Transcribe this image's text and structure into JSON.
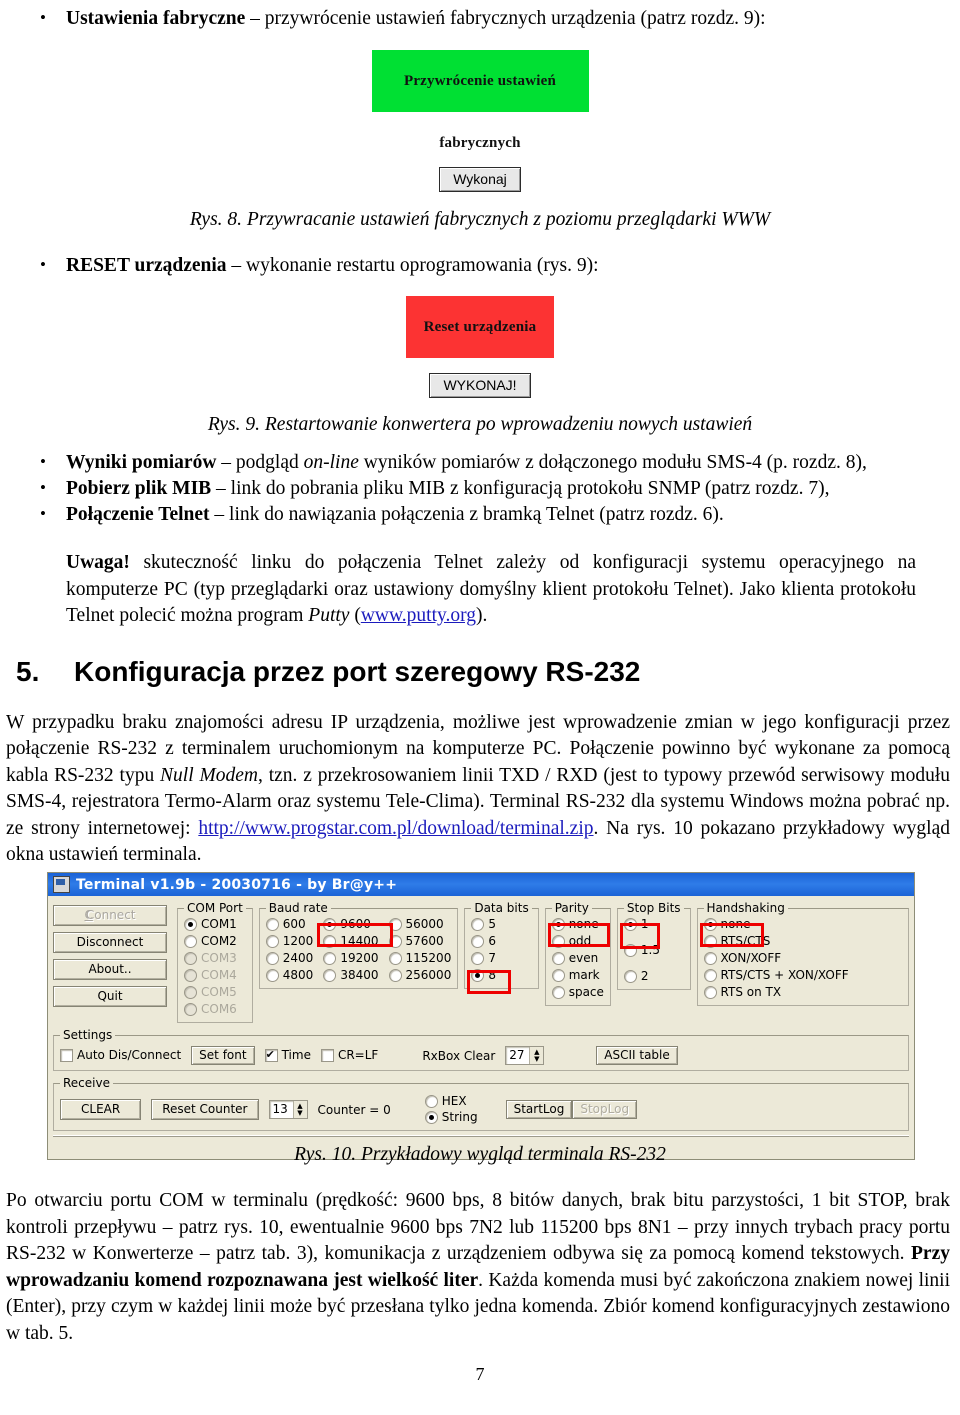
{
  "bullets_top": [
    {
      "label": "Ustawienia fabryczne",
      "rest": " – przywrócenie ustawień fabrycznych urządzenia (patrz rozdz. 9):"
    },
    {
      "label": "RESET urządzenia",
      "rest": " – wykonanie restartu oprogramowania (rys. 9):"
    }
  ],
  "figure8": {
    "banner_label": "Przywrócenie ustawień fabrycznych",
    "banner_color": "#00e033",
    "button_label": "Wykonaj",
    "caption": "Rys. 8. Przywracanie ustawień fabrycznych z poziomu przeglądarki WWW"
  },
  "figure9": {
    "banner_label": "Reset urządzenia",
    "banner_color": "#fc3333",
    "button_label": "WYKONAJ!",
    "caption": "Rys. 9. Restartowanie konwertera po wprowadzeniu nowych ustawień"
  },
  "bullets_links": [
    {
      "label": "Wyniki pomiarów",
      "pre": " – podgląd ",
      "em": "on-line",
      "post": " wyników pomiarów z dołączonego modułu SMS-4 (p. rozdz. 8),"
    },
    {
      "label": "Pobierz plik MIB",
      "pre": " – link do pobrania pliku MIB z konfiguracją protokołu SNMP (patrz rozdz. 7),",
      "em": "",
      "post": ""
    },
    {
      "label": "Połączenie Telnet",
      "pre": " – link do nawiązania połączenia z bramką Telnet (patrz rozdz. 6).",
      "em": "",
      "post": ""
    }
  ],
  "note": {
    "label": "Uwaga!",
    "text_1": " skuteczność linku do połączenia Telnet zależy od konfiguracji systemu operacyjnego na komputerze PC (typ przeglądarki oraz ustawiony domyślny klient protokołu Telnet). Jako klienta protokołu Telnet polecić można program ",
    "program": "Putty",
    "open_paren": " (",
    "link": "www.putty.org",
    "close_paren": ")."
  },
  "section5": {
    "number": "5.",
    "title": "Konfiguracja przez port szeregowy RS-232",
    "para_1": "W przypadku braku znajomości adresu IP urządzenia, możliwe jest wprowadzenie zmian w jego konfiguracji przez połączenie RS-232 z terminalem uruchomionym na komputerze PC. Połączenie powinno być wykonane za pomocą kabla RS-232 typu ",
    "em_1": "Null Modem",
    "para_2": ", tzn. z przekrosowaniem linii TXD / RXD (jest to typowy przewód serwisowy modułu SMS-4, rejestratora Termo-Alarm oraz systemu Tele-Clima). Terminal RS-232 dla systemu Windows można pobrać np. ze strony internetowej: ",
    "link": "http://www.progstar.com.pl/download/terminal.zip",
    "para_3": ". Na rys. 10 pokazano przykładowy wygląd okna ustawień terminala."
  },
  "terminal": {
    "title": "Terminal v1.9b - 20030716 - by Br@y++",
    "title_bar_color": "#1b63d6",
    "highlight_color": "#ee0000",
    "buttons": [
      {
        "label": "Connect",
        "disabled": true
      },
      {
        "label": "Disconnect",
        "disabled": false
      },
      {
        "label": "About..",
        "disabled": false
      },
      {
        "label": "Quit",
        "disabled": false
      }
    ],
    "com_port": {
      "legend": "COM Port",
      "options": [
        {
          "label": "COM1",
          "selected": true,
          "disabled": false
        },
        {
          "label": "COM2",
          "selected": false,
          "disabled": false
        },
        {
          "label": "COM3",
          "selected": false,
          "disabled": true
        },
        {
          "label": "COM4",
          "selected": false,
          "disabled": true
        },
        {
          "label": "COM5",
          "selected": false,
          "disabled": true
        },
        {
          "label": "COM6",
          "selected": false,
          "disabled": true
        }
      ]
    },
    "baud_rate": {
      "legend": "Baud rate",
      "columns": [
        [
          {
            "label": "600",
            "selected": false
          },
          {
            "label": "1200",
            "selected": false
          },
          {
            "label": "2400",
            "selected": false
          },
          {
            "label": "4800",
            "selected": false
          }
        ],
        [
          {
            "label": "9600",
            "selected": true
          },
          {
            "label": "14400",
            "selected": false
          },
          {
            "label": "19200",
            "selected": false
          },
          {
            "label": "38400",
            "selected": false
          }
        ],
        [
          {
            "label": "56000",
            "selected": false
          },
          {
            "label": "57600",
            "selected": false
          },
          {
            "label": "115200",
            "selected": false
          },
          {
            "label": "256000",
            "selected": false
          }
        ]
      ]
    },
    "data_bits": {
      "legend": "Data bits",
      "options": [
        {
          "label": "5",
          "selected": false
        },
        {
          "label": "6",
          "selected": false
        },
        {
          "label": "7",
          "selected": false
        },
        {
          "label": "8",
          "selected": true
        }
      ]
    },
    "parity": {
      "legend": "Parity",
      "options": [
        {
          "label": "none",
          "selected": true
        },
        {
          "label": "odd",
          "selected": false
        },
        {
          "label": "even",
          "selected": false
        },
        {
          "label": "mark",
          "selected": false
        },
        {
          "label": "space",
          "selected": false
        }
      ]
    },
    "stop_bits": {
      "legend": "Stop Bits",
      "options": [
        {
          "label": "1",
          "selected": true
        },
        {
          "label": "1.5",
          "selected": false
        },
        {
          "label": "2",
          "selected": false
        }
      ]
    },
    "handshaking": {
      "legend": "Handshaking",
      "options": [
        {
          "label": "none",
          "selected": true
        },
        {
          "label": "RTS/CTS",
          "selected": false
        },
        {
          "label": "XON/XOFF",
          "selected": false
        },
        {
          "label": "RTS/CTS + XON/XOFF",
          "selected": false
        },
        {
          "label": "RTS on TX",
          "selected": false
        }
      ]
    },
    "settings": {
      "legend": "Settings",
      "auto_dis_connect": {
        "label": "Auto Dis/Connect",
        "checked": false
      },
      "set_font": "Set font",
      "time": {
        "label": "Time",
        "checked": true
      },
      "crlf": {
        "label": "CR=LF",
        "checked": false
      },
      "rxbox_clear_label": "RxBox Clear",
      "rxbox_clear_value": "27",
      "ascii_table": "ASCII table"
    },
    "receive": {
      "legend": "Receive",
      "clear": "CLEAR",
      "reset_counter": "Reset Counter",
      "counter_value": "13",
      "counter_label": "Counter = 0",
      "hex": {
        "label": "HEX",
        "selected": false
      },
      "string": {
        "label": "String",
        "selected": true
      },
      "startlog": {
        "label": "StartLog",
        "disabled": false
      },
      "stoplog": {
        "label": "StopLog",
        "disabled": true
      }
    }
  },
  "figure10": {
    "caption": "Rys. 10. Przykładowy wygląd terminala RS-232"
  },
  "final_para": {
    "text_1": "Po otwarciu portu COM w terminalu (prędkość: 9600 bps, 8 bitów danych, brak bitu parzystości, 1 bit STOP, brak kontroli przepływu – patrz rys. 10, ewentualnie 9600 bps 7N2 lub 115200 bps 8N1 – przy innych trybach pracy portu RS-232 w Konwerterze – patrz tab. 3), komunikacja z urządzeniem odbywa się za pomocą komend tekstowych. ",
    "bold": "Przy wprowadzaniu komend rozpoznawana jest wielkość liter",
    "text_2": ". Każda komenda musi być zakończona znakiem nowej linii (Enter), przy czym w każdej linii może być przesłana tylko jedna komenda. Zbiór komend konfiguracyjnych zestawiono w tab. 5."
  },
  "page_number": "7"
}
